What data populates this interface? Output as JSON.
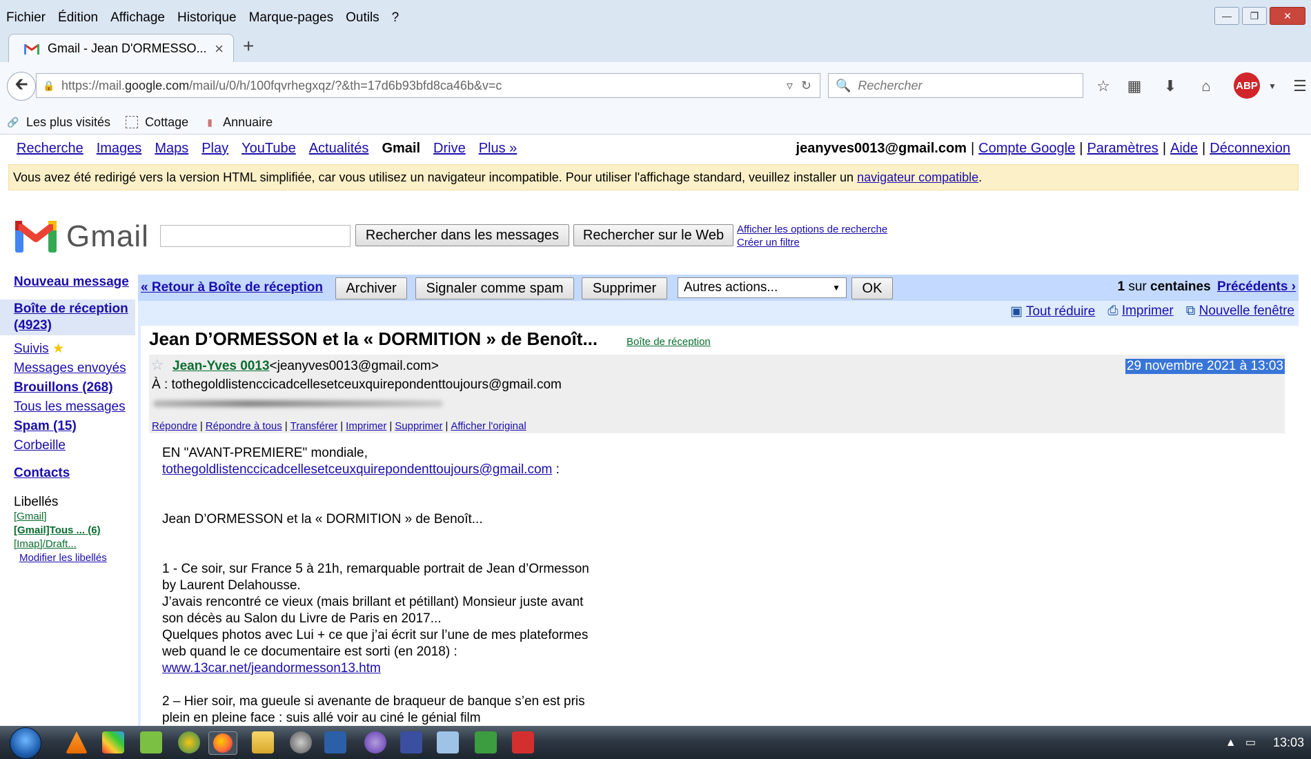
{
  "browser": {
    "menu": [
      "Fichier",
      "Édition",
      "Affichage",
      "Historique",
      "Marque-pages",
      "Outils",
      "?"
    ],
    "tab_title": "Gmail - Jean D'ORMESSO...",
    "url_prefix": "https://mail.",
    "url_domain": "google.com",
    "url_rest": "/mail/u/0/h/100fqvrhegxqz/?&th=17d6b93bfd8ca46b&v=c",
    "search_placeholder": "Rechercher",
    "abp_label": "ABP",
    "bookmarks": [
      "Les plus visités",
      "Cottage",
      "Annuaire"
    ]
  },
  "google_bar": {
    "links": [
      "Recherche",
      "Images",
      "Maps",
      "Play",
      "YouTube",
      "Actualités",
      "Gmail",
      "Drive",
      "Plus »"
    ],
    "current": "Gmail",
    "user_email": "jeanyves0013@gmail.com",
    "right_links": [
      "Compte Google",
      "Paramètres",
      "Aide",
      "Déconnexion"
    ]
  },
  "notice": {
    "text": "Vous avez été redirigé vers la version HTML simplifiée, car vous utilisez un navigateur incompatible. Pour utiliser l'affichage standard, veuillez installer un ",
    "link": "navigateur compatible",
    "end": "."
  },
  "header": {
    "logo_text": "Gmail",
    "search_mail_button": "Rechercher dans les messages",
    "search_web_button": "Rechercher sur le Web",
    "search_options_link": "Afficher les options de recherche",
    "create_filter_link": "Créer un filtre"
  },
  "sidebar": {
    "compose": "Nouveau message",
    "inbox": "Boîte de réception (4923)",
    "starred": "Suivis",
    "sent": "Messages envoyés",
    "drafts": "Brouillons (268)",
    "all_mail": "Tous les messages",
    "spam": "Spam (15)",
    "trash": "Corbeille",
    "contacts": "Contacts",
    "labels_title": "Libellés",
    "labels": [
      "[Gmail]",
      "[Gmail]Tous ... (6)",
      "[Imap]/Draft..."
    ],
    "edit_labels": "Modifier les libellés"
  },
  "actions": {
    "back": "« Retour à Boîte de réception",
    "archive": "Archiver",
    "spam": "Signaler comme spam",
    "delete": "Supprimer",
    "more_actions": "Autres actions...",
    "ok": "OK",
    "paging_count": "1",
    "paging_of": " sur ",
    "paging_total": "centaines",
    "paging_prev": "Précédents ›",
    "collapse": "Tout réduire",
    "print": "Imprimer",
    "new_window": "Nouvelle fenêtre"
  },
  "message": {
    "subject": "Jean D’ORMESSON et la « DORMITION » de Benoît...",
    "label": "Boîte de réception",
    "sender_name": "Jean-Yves 0013",
    "sender_email": "<jeanyves0013@gmail.com>",
    "date": "29 novembre 2021 à 13:03",
    "to": "À : tothegoldlistenccicadcellesetceuxquirepondenttoujours@gmail.com",
    "links": [
      "Répondre",
      "Répondre à tous",
      "Transférer",
      "Imprimer",
      "Supprimer",
      "Afficher l'original"
    ],
    "body_l1": "EN \"AVANT-PREMIERE\" mondiale,",
    "body_link1": "tothegoldlistenccicadcellesetceuxquirepondenttoujours@gmail.com",
    "body_l1b": " :",
    "body_l2": "Jean D’ORMESSON et la « DORMITION » de Benoît...",
    "body_l3": "1 - Ce soir, sur France 5 à 21h, remarquable portrait de Jean d’Ormesson by Laurent Delahousse.",
    "body_l4": "J’avais rencontré ce vieux (mais brillant et pétillant) Monsieur juste avant son décès au Salon du Livre de Paris en 2017...",
    "body_l5": "Quelques photos avec Lui +  ce que j’ai écrit sur l’une de mes plateformes web quand le ce documentaire est sorti (en 2018) :",
    "body_link2": "www.13car.net/jeandormesson13.htm",
    "body_l6": "2 – Hier soir, ma gueule si avenante de braqueur de banque s’en est pris plein en pleine face : suis allé voir au ciné le génial film"
  },
  "taskbar": {
    "clock": "13:03"
  }
}
